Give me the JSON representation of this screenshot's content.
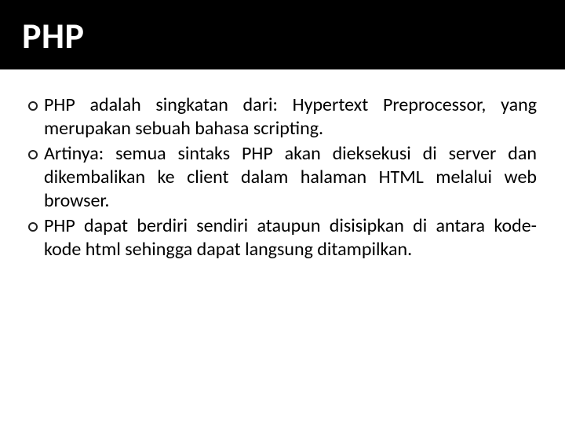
{
  "header": {
    "title": "PHP"
  },
  "bullets": [
    {
      "text": "PHP adalah singkatan dari: Hypertext Preprocessor, yang merupakan sebuah bahasa scripting."
    },
    {
      "text": "Artinya: semua sintaks PHP akan dieksekusi di server dan dikembalikan ke client dalam halaman HTML melalui web browser."
    },
    {
      "text": "PHP dapat berdiri sendiri ataupun disisipkan di antara kode-kode html sehingga dapat langsung ditampilkan."
    }
  ]
}
